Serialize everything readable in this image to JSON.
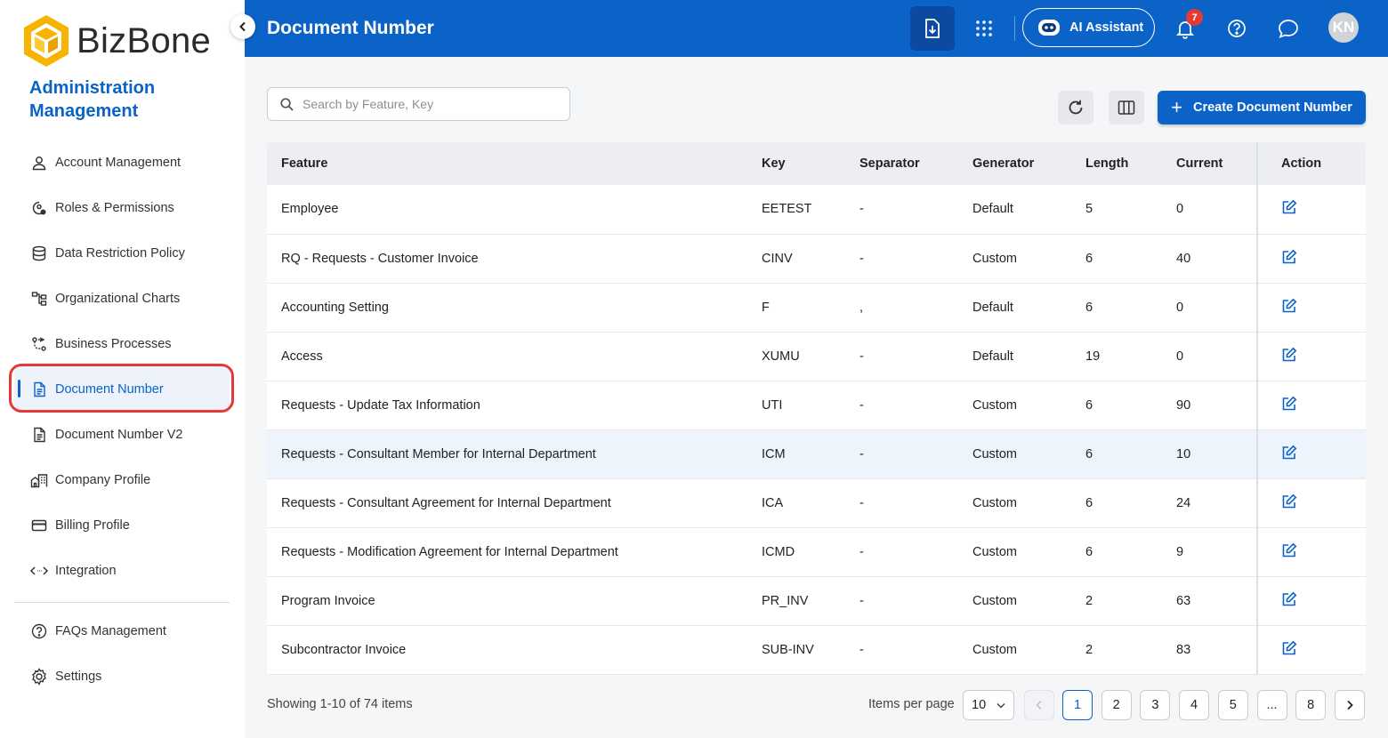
{
  "brand": {
    "name": "BizBone"
  },
  "sidebar": {
    "section_title": "Administration Management",
    "items": [
      {
        "label": "Account Management",
        "icon": "user-icon"
      },
      {
        "label": "Roles & Permissions",
        "icon": "roles-icon"
      },
      {
        "label": "Data Restriction Policy",
        "icon": "database-icon"
      },
      {
        "label": "Organizational Charts",
        "icon": "org-chart-icon"
      },
      {
        "label": "Business Processes",
        "icon": "process-icon"
      },
      {
        "label": "Document Number",
        "icon": "document-icon",
        "active": true
      },
      {
        "label": "Document Number V2",
        "icon": "document-icon"
      },
      {
        "label": "Company Profile",
        "icon": "company-icon"
      },
      {
        "label": "Billing Profile",
        "icon": "card-icon"
      },
      {
        "label": "Integration",
        "icon": "code-icon"
      }
    ],
    "bottom_items": [
      {
        "label": "FAQs Management",
        "icon": "help-icon"
      },
      {
        "label": "Settings",
        "icon": "gear-icon"
      }
    ]
  },
  "header": {
    "title": "Document Number",
    "ai_assistant_label": "AI Assistant",
    "notification_count": "7",
    "avatar_initials": "KN",
    "accent_color": "#0b63c8"
  },
  "toolbar": {
    "search_placeholder": "Search by Feature, Key",
    "create_label": "Create Document Number"
  },
  "table": {
    "columns": [
      "Feature",
      "Key",
      "Separator",
      "Generator",
      "Length",
      "Current",
      "Action"
    ],
    "rows": [
      {
        "feature": "Employee",
        "key": "EETEST",
        "separator": "-",
        "generator": "Default",
        "length": "5",
        "current": "0"
      },
      {
        "feature": "RQ - Requests - Customer Invoice",
        "key": "CINV",
        "separator": "-",
        "generator": "Custom",
        "length": "6",
        "current": "40"
      },
      {
        "feature": "Accounting Setting",
        "key": "F",
        "separator": ",",
        "generator": "Default",
        "length": "6",
        "current": "0"
      },
      {
        "feature": "Access",
        "key": "XUMU",
        "separator": "-",
        "generator": "Default",
        "length": "19",
        "current": "0"
      },
      {
        "feature": "Requests - Update Tax Information",
        "key": "UTI",
        "separator": "-",
        "generator": "Custom",
        "length": "6",
        "current": "90"
      },
      {
        "feature": "Requests - Consultant Member for Internal Department",
        "key": "ICM",
        "separator": "-",
        "generator": "Custom",
        "length": "6",
        "current": "10",
        "highlight": true
      },
      {
        "feature": "Requests - Consultant Agreement for Internal Department",
        "key": "ICA",
        "separator": "-",
        "generator": "Custom",
        "length": "6",
        "current": "24"
      },
      {
        "feature": "Requests - Modification Agreement for Internal Department",
        "key": "ICMD",
        "separator": "-",
        "generator": "Custom",
        "length": "6",
        "current": "9"
      },
      {
        "feature": "Program Invoice",
        "key": "PR_INV",
        "separator": "-",
        "generator": "Custom",
        "length": "2",
        "current": "63"
      },
      {
        "feature": "Subcontractor Invoice",
        "key": "SUB-INV",
        "separator": "-",
        "generator": "Custom",
        "length": "2",
        "current": "83"
      }
    ]
  },
  "footer": {
    "showing_text": "Showing 1-10 of 74 items",
    "items_per_page_label": "Items per page",
    "items_per_page_value": "10",
    "pages": [
      "1",
      "2",
      "3",
      "4",
      "5",
      "...",
      "8"
    ],
    "current_page": "1"
  }
}
